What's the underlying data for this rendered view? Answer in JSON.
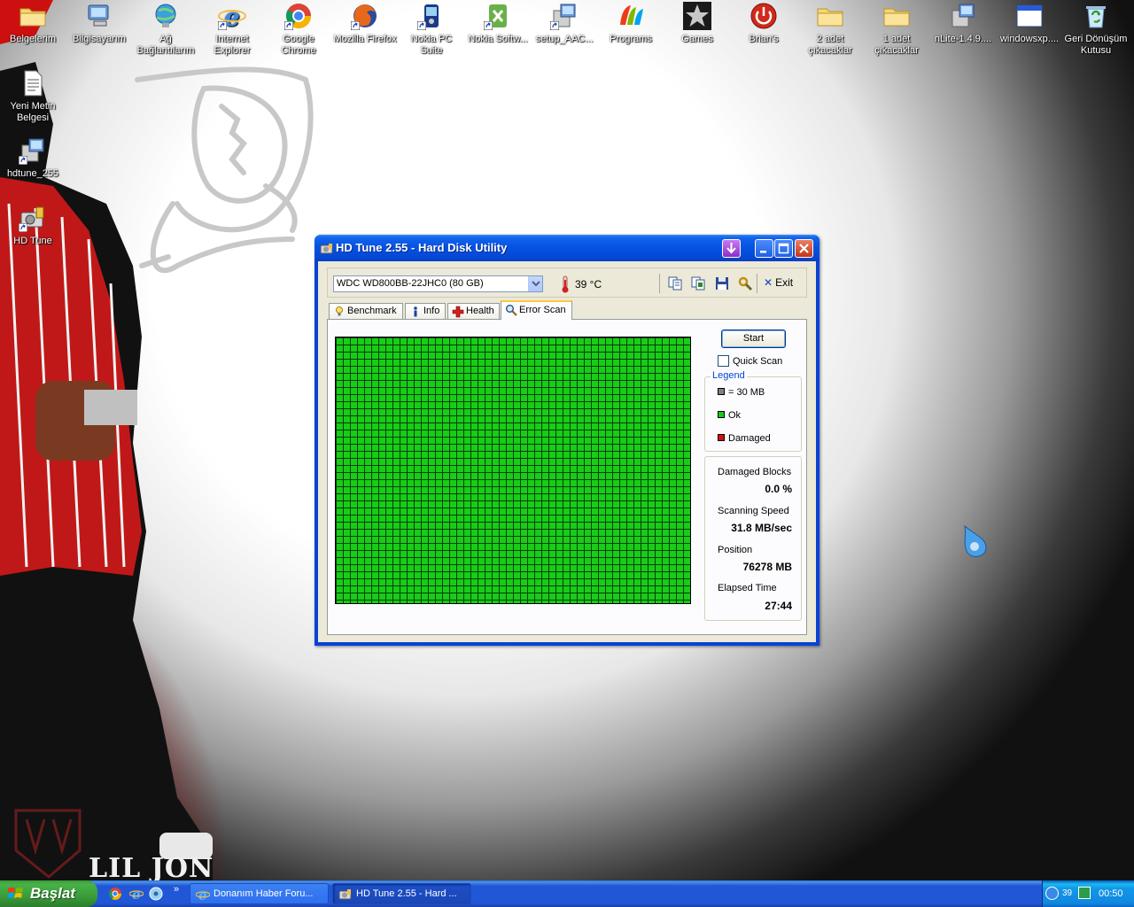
{
  "desktop": {
    "icons_top": [
      {
        "label": "Belgelerim",
        "icon": "folder-icon"
      },
      {
        "label": "Bilgisayarım",
        "icon": "computer-icon"
      },
      {
        "label": "Ağ Bağlantılarım",
        "icon": "network-icon"
      },
      {
        "label": "Internet Explorer",
        "icon": "ie-icon"
      },
      {
        "label": "Google Chrome",
        "icon": "chrome-icon"
      },
      {
        "label": "Mozilla Firefox",
        "icon": "firefox-icon"
      },
      {
        "label": "Nokia PC Suite",
        "icon": "nokia-icon"
      },
      {
        "label": "Nokia Softw...",
        "icon": "nokia-software-icon"
      },
      {
        "label": "setup_AAC...",
        "icon": "installer-icon"
      },
      {
        "label": "Programs",
        "icon": "msn-icon"
      },
      {
        "label": "Games",
        "icon": "star-icon"
      },
      {
        "label": "Brian's",
        "icon": "power-icon"
      },
      {
        "label": "2 adet çıkacaklar",
        "icon": "folder-icon"
      },
      {
        "label": "1 adet çıkacaklar",
        "icon": "folder-icon"
      },
      {
        "label": "nLite-1.4.9....",
        "icon": "installer-icon"
      },
      {
        "label": "windowsxp....",
        "icon": "window-icon"
      },
      {
        "label": "Geri Dönüşüm Kutusu",
        "icon": "recycle-bin-icon"
      }
    ],
    "icons_left": [
      {
        "label": "Yeni Metin Belgesi",
        "icon": "text-document-icon"
      },
      {
        "label": "hdtune_255",
        "icon": "installer-icon"
      },
      {
        "label": "HD Tune",
        "icon": "hd-tune-icon"
      }
    ],
    "wallpaper_text": "LIL JON"
  },
  "window": {
    "title": "HD Tune 2.55 - Hard Disk Utility",
    "toolbar": {
      "drive": "WDC WD800BB-22JHC0 (80 GB)",
      "temperature": "39 °C",
      "exit_label": "Exit"
    },
    "tabs": [
      {
        "label": "Benchmark",
        "icon": "lightbulb-icon"
      },
      {
        "label": "Info",
        "icon": "info-icon"
      },
      {
        "label": "Health",
        "icon": "health-cross-icon"
      },
      {
        "label": "Error Scan",
        "icon": "magnifier-icon"
      }
    ],
    "active_tab": "Error Scan",
    "error_scan": {
      "start_label": "Start",
      "quick_scan_label": "Quick Scan",
      "quick_scan_checked": false,
      "legend_title": "Legend",
      "legend": [
        {
          "label": "= 30 MB",
          "color": "#808080"
        },
        {
          "label": "Ok",
          "color": "#18cc18"
        },
        {
          "label": "Damaged",
          "color": "#d01010"
        }
      ],
      "grid_color": "#18cc18",
      "stats": {
        "damaged_blocks_label": "Damaged Blocks",
        "damaged_blocks_value": "0.0 %",
        "scanning_speed_label": "Scanning Speed",
        "scanning_speed_value": "31.8 MB/sec",
        "position_label": "Position",
        "position_value": "76278 MB",
        "elapsed_label": "Elapsed Time",
        "elapsed_value": "27:44"
      }
    }
  },
  "taskbar": {
    "start_label": "Başlat",
    "quick_launch": [
      "chrome-icon",
      "ie-icon",
      "media-icon"
    ],
    "tasks": [
      {
        "label": "Donanım Haber Foru...",
        "icon": "ie-icon",
        "active": false
      },
      {
        "label": "HD Tune 2.55 - Hard ...",
        "icon": "hd-tune-icon",
        "active": true
      }
    ],
    "tray_temp": "39",
    "clock": "00:50"
  }
}
